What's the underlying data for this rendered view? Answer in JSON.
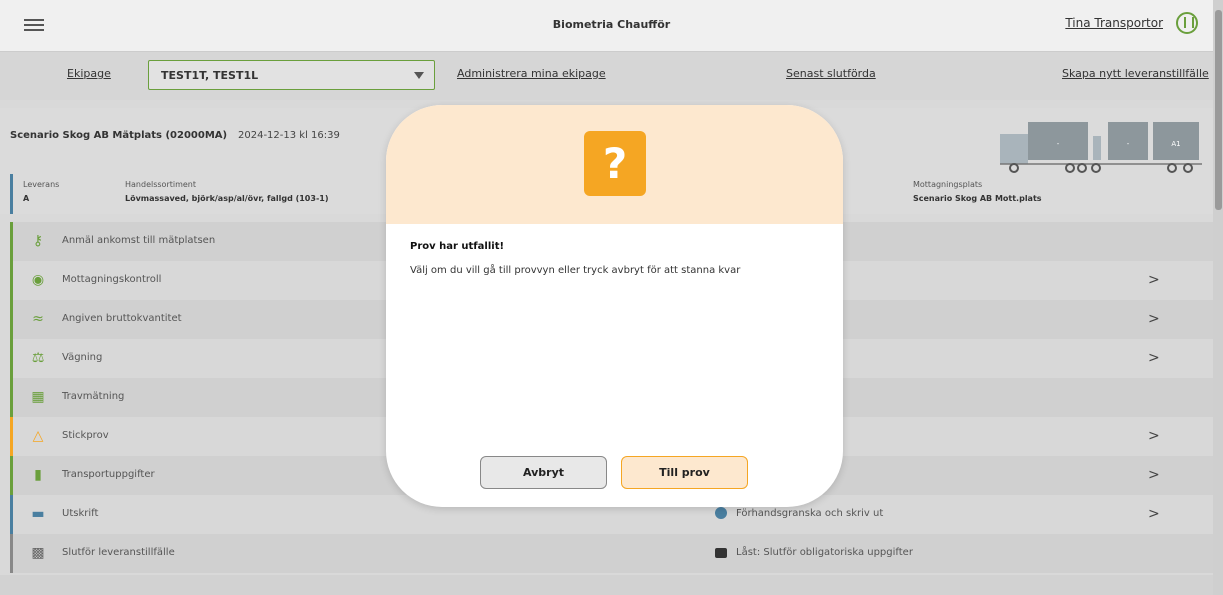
{
  "header": {
    "title": "Biometria Chaufför",
    "user_name": "Tina Transportor",
    "menu_icon": "hamburger-menu-icon",
    "user_icon": "user-circle-icon"
  },
  "ekipage_bar": {
    "label": "Ekipage",
    "selected": "TEST1T, TEST1L",
    "links": {
      "manage": "Administrera mina ekipage",
      "recent": "Senast slutförda",
      "create": "Skapa nytt leveranstillfälle"
    }
  },
  "delivery": {
    "title": "Scenario Skog AB Mätplats (02000MA)",
    "datetime": "2024-12-13 kl 16:39",
    "leverans_label": "Leverans",
    "leverans_value": "A",
    "sortiment_label": "Handelssortiment",
    "sortiment_value": "Lövmassaved, björk/asp/al/övr, fallgd (103-1)",
    "mottagning_label": "Mottagningsplats",
    "mottagning_value": "Scenario Skog AB Mott.plats",
    "truck": {
      "unit1": "-",
      "unit2": "-",
      "unit3": "A1"
    }
  },
  "steps": [
    {
      "label": "Anmäl ankomst till mätplatsen",
      "icon": "key-icon",
      "arrow": ""
    },
    {
      "label": "Mottagningskontroll",
      "icon": "eye-icon",
      "arrow": ">"
    },
    {
      "label": "Angiven bruttokvantitet",
      "icon": "approx-icon",
      "arrow": ">"
    },
    {
      "label": "Vägning",
      "icon": "scale-icon",
      "arrow": ">"
    },
    {
      "label": "Travmätning",
      "icon": "log-stack-icon",
      "arrow": ""
    },
    {
      "label": "Stickprov",
      "icon": "warning-sample-icon",
      "arrow": ">"
    },
    {
      "label": "Transportuppgifter",
      "icon": "document-icon",
      "arrow": ">"
    },
    {
      "label": "Utskrift",
      "icon": "printer-icon",
      "arrow": ">",
      "right_status": "Förhandsgranska och skriv ut"
    },
    {
      "label": "Slutför leveranstillfälle",
      "icon": "checkered-flag-icon",
      "arrow": "",
      "right_status": "Låst: Slutför obligatoriska uppgifter"
    }
  ],
  "colors": {
    "accent_green": "#6a9f3c",
    "accent_orange": "#f5a623",
    "modal_header_bg": "#fde8cf"
  },
  "modal": {
    "icon": "question-mark-icon",
    "icon_glyph": "?",
    "title": "Prov har utfallit!",
    "message": "Välj om du vill gå till provvyn eller tryck avbryt för att stanna kvar",
    "cancel_label": "Avbryt",
    "confirm_label": "Till prov"
  }
}
